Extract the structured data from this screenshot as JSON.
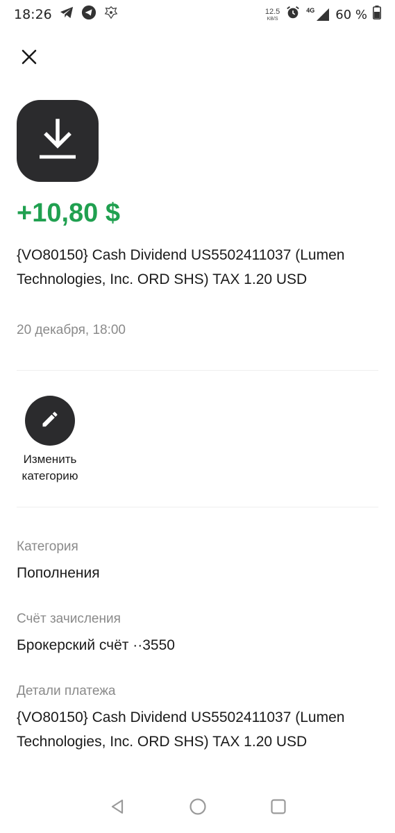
{
  "status_bar": {
    "time": "18:26",
    "net_speed": "12.5",
    "net_unit": "KB/S",
    "network": "4G",
    "battery": "60 %"
  },
  "transaction": {
    "icon": "download-icon",
    "amount": "+10,80 $",
    "amount_color": "#20a050",
    "description": "{VO80150} Cash Dividend US5502411037 (Lumen Technologies, Inc. ORD SHS) TAX 1.20 USD",
    "date": "20 декабря, 18:00"
  },
  "actions": {
    "change_category_label": "Изменить категорию",
    "change_category_icon": "pencil-icon"
  },
  "details": {
    "category_label": "Категория",
    "category_value": "Пополнения",
    "account_label": "Счёт зачисления",
    "account_value": "Брокерский счёт ··3550",
    "payment_details_label": "Детали платежа",
    "payment_details_value": "{VO80150} Cash Dividend US5502411037 (Lumen Technologies, Inc. ORD SHS) TAX 1.20 USD"
  }
}
